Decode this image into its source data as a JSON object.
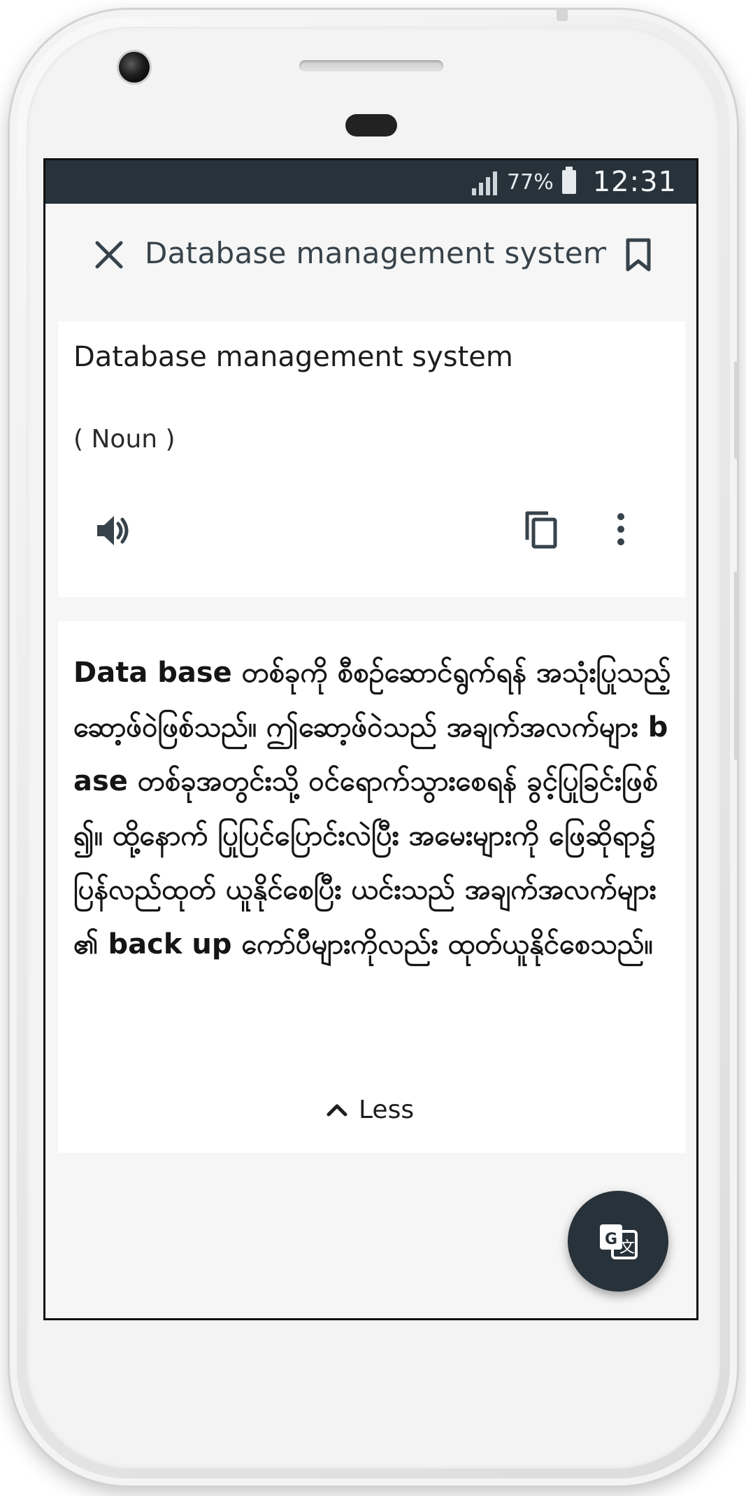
{
  "status_bar": {
    "battery_percent": "77%",
    "time": "12:31"
  },
  "app_bar": {
    "title": "Database management system",
    "close_icon": "close-icon",
    "bookmark_icon": "bookmark-icon"
  },
  "entry": {
    "word": "Database management system",
    "part_of_speech": "( Noun )",
    "actions": [
      "speaker-icon",
      "copy-icon",
      "more-vert-icon"
    ]
  },
  "definition": {
    "text": "Data base တစ်ခုကို စီစဉ်ဆောင်ရွက်ရန် အသုံးပြုသည့် ဆော့ဖ်ဝဲဖြစ်သည်။ ဤဆော့ဖ်ဝဲသည် အချက်အလက်များ base တစ်ခုအတွင်းသို့ ဝင်ရောက်သွားစေရန် ခွင့်ပြုခြင်းဖြစ်၍။ ထို့နောက် ပြုပြင်ပြောင်းလဲပြီး အမေးများကို ဖြေဆိုရာ၌ ပြန်လည်ထုတ် ယူနိုင်စေပြီး ယင်းသည် အချက်အလက်များ၏ back up ကော်ပီများကိုလည်း ထုတ်ယူနိုင်စေသည်။",
    "less_label": "Less"
  },
  "fab": {
    "icon": "translate-icon"
  },
  "colors": {
    "status_bar_bg": "#27323a",
    "app_bg": "#f6f6f6",
    "card_bg": "#ffffff",
    "fab_bg": "#27323a"
  }
}
